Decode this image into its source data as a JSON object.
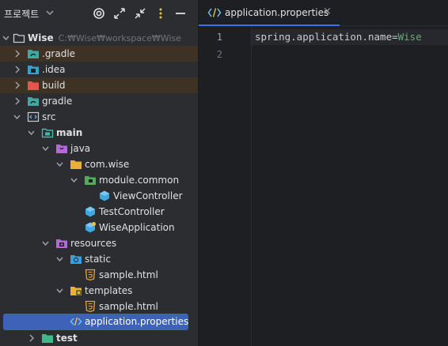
{
  "project_panel": {
    "title": "프로젝트",
    "header_icons": [
      "locate-icon",
      "expand-all-icon",
      "collapse-all-icon",
      "options-icon",
      "hide-icon"
    ],
    "tree": [
      {
        "label": "Wise",
        "path": "C:₩Wise₩workspace₩Wise",
        "icon": "folder-icon",
        "expanded": true,
        "bold": true
      },
      {
        "label": ".gradle",
        "icon": "folder-icon",
        "expanded": false
      },
      {
        "label": ".idea",
        "icon": "folder-icon",
        "expanded": false
      },
      {
        "label": "build",
        "icon": "folder-icon",
        "expanded": false
      },
      {
        "label": "gradle",
        "icon": "folder-icon",
        "expanded": false
      },
      {
        "label": "src",
        "icon": "source-folder-icon",
        "expanded": true
      },
      {
        "label": "main",
        "icon": "module-folder-icon",
        "expanded": true,
        "bold": true
      },
      {
        "label": "java",
        "icon": "source-root-icon",
        "expanded": true
      },
      {
        "label": "com.wise",
        "icon": "package-icon",
        "expanded": true
      },
      {
        "label": "module.common",
        "icon": "package-icon",
        "expanded": true
      },
      {
        "label": "ViewController",
        "icon": "class-icon"
      },
      {
        "label": "TestController",
        "icon": "class-icon"
      },
      {
        "label": "WiseApplication",
        "icon": "spring-class-icon"
      },
      {
        "label": "resources",
        "icon": "resources-folder-icon",
        "expanded": true
      },
      {
        "label": "static",
        "icon": "web-folder-icon",
        "expanded": true
      },
      {
        "label": "sample.html",
        "icon": "html-file-icon"
      },
      {
        "label": "templates",
        "icon": "package-icon",
        "expanded": true
      },
      {
        "label": "sample.html",
        "icon": "html-file-icon"
      },
      {
        "label": "application.properties",
        "icon": "properties-file-icon",
        "selected": true
      },
      {
        "label": "test",
        "icon": "test-folder-icon",
        "expanded": false,
        "bold": true
      }
    ]
  },
  "editor": {
    "tab": {
      "label": "application.properties",
      "close": "×"
    },
    "line_numbers": [
      "1",
      "2"
    ],
    "lines": [
      {
        "key": "spring.application.name",
        "eq": "=",
        "value": "Wise"
      },
      {
        "key": "",
        "eq": "",
        "value": ""
      }
    ]
  },
  "colors": {
    "panel_bg": "#2b2d30",
    "editor_bg": "#1e1f22",
    "selection": "#3d62b7",
    "excluded_row": "#3d3223",
    "string_value": "#6aab73"
  }
}
